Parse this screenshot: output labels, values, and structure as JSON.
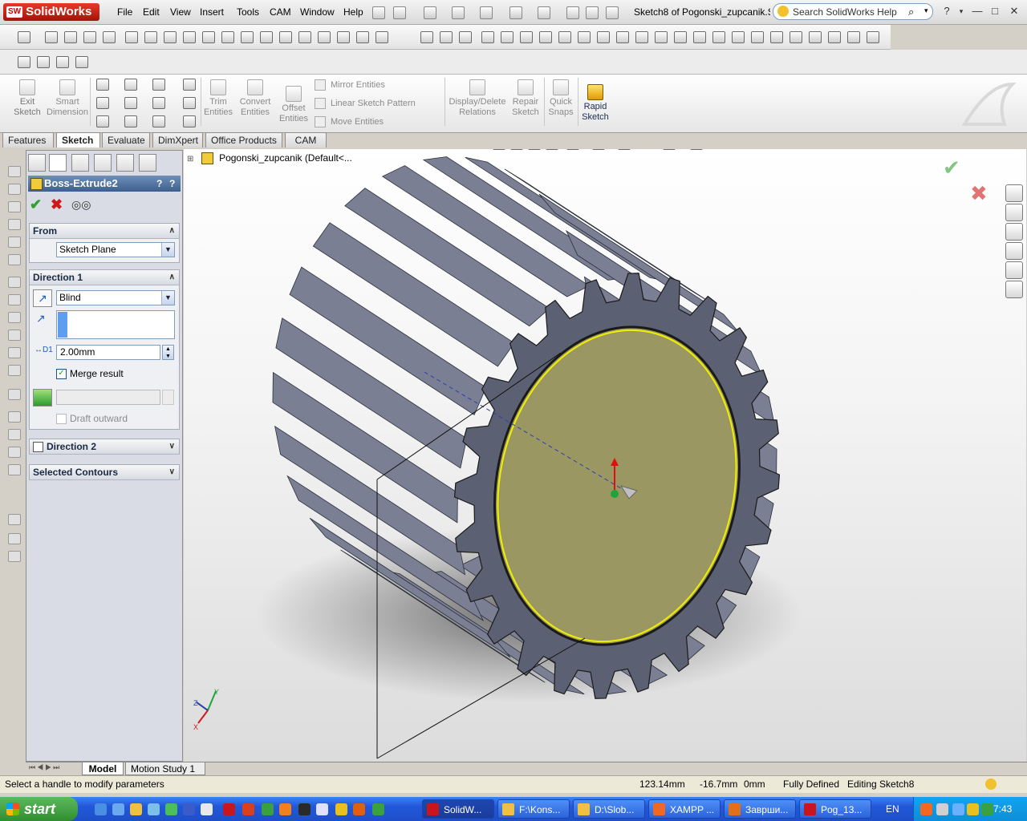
{
  "app": {
    "brand": "SolidWorks",
    "document_title": "Sketch8 of Pogonski_zupcanik.S...",
    "search_placeholder": "Search SolidWorks Help",
    "help_icon": "?"
  },
  "menu": [
    "File",
    "Edit",
    "View",
    "Insert",
    "Tools",
    "CAM",
    "Window",
    "Help"
  ],
  "command_manager": {
    "exit_sketch": "Exit\nSketch",
    "smart_dimension": "Smart\nDimension",
    "trim_entities": "Trim\nEntities",
    "convert_entities": "Convert\nEntities",
    "offset_entities": "Offset\nEntities",
    "mirror_entities": "Mirror Entities",
    "linear_sketch_pattern": "Linear Sketch Pattern",
    "move_entities": "Move Entities",
    "display_delete_relations": "Display/Delete\nRelations",
    "repair_sketch": "Repair\nSketch",
    "quick_snaps": "Quick\nSnaps",
    "rapid_sketch": "Rapid\nSketch"
  },
  "tabs": [
    "Features",
    "Sketch",
    "Evaluate",
    "DimXpert",
    "Office Products",
    "CAM"
  ],
  "active_tab": "Sketch",
  "property_manager": {
    "title": "Boss-Extrude2",
    "from_group": {
      "label": "From",
      "value": "Sketch Plane"
    },
    "direction1": {
      "label": "Direction 1",
      "end_condition": "Blind",
      "depth": "2.00mm",
      "merge_result_label": "Merge result",
      "merge_result_checked": true,
      "draft_outward_label": "Draft outward",
      "draft_outward_checked": false
    },
    "direction2": {
      "label": "Direction 2",
      "checked": false
    },
    "selected_contours": {
      "label": "Selected Contours"
    }
  },
  "feature_tree": {
    "part_name": "Pogonski_zupcanik  (Default<..."
  },
  "bottom_tabs": [
    "Model",
    "Motion Study 1"
  ],
  "active_bottom_tab": "Model",
  "status_bar": {
    "message": "Select a handle to modify parameters",
    "x": "123.14mm",
    "y": "-16.7mm",
    "z": "0mm",
    "state": "Fully Defined",
    "mode": "Editing Sketch8"
  },
  "taskbar": {
    "start": "start",
    "tasks": [
      {
        "label": "SolidW...",
        "active": true,
        "icon_color": "#c8161e"
      },
      {
        "label": "F:\\Kons...",
        "active": false,
        "icon_color": "#f0c040"
      },
      {
        "label": "D:\\Slob...",
        "active": false,
        "icon_color": "#f0c040"
      },
      {
        "label": "XAMPP ...",
        "active": false,
        "icon_color": "#f26822"
      },
      {
        "label": "Заврши...",
        "active": false,
        "icon_color": "#e0701a"
      },
      {
        "label": "Pog_13...",
        "active": false,
        "icon_color": "#c8161e"
      }
    ],
    "language": "EN",
    "clock": "7:43"
  },
  "colors": {
    "gear_body": "#7a7f93",
    "gear_face_dark": "#5b6072",
    "sketch_face": "#a3a06a",
    "sketch_outline": "#f0ef00",
    "confirm_green": "#2fa12f",
    "cancel_red": "#d01818"
  }
}
